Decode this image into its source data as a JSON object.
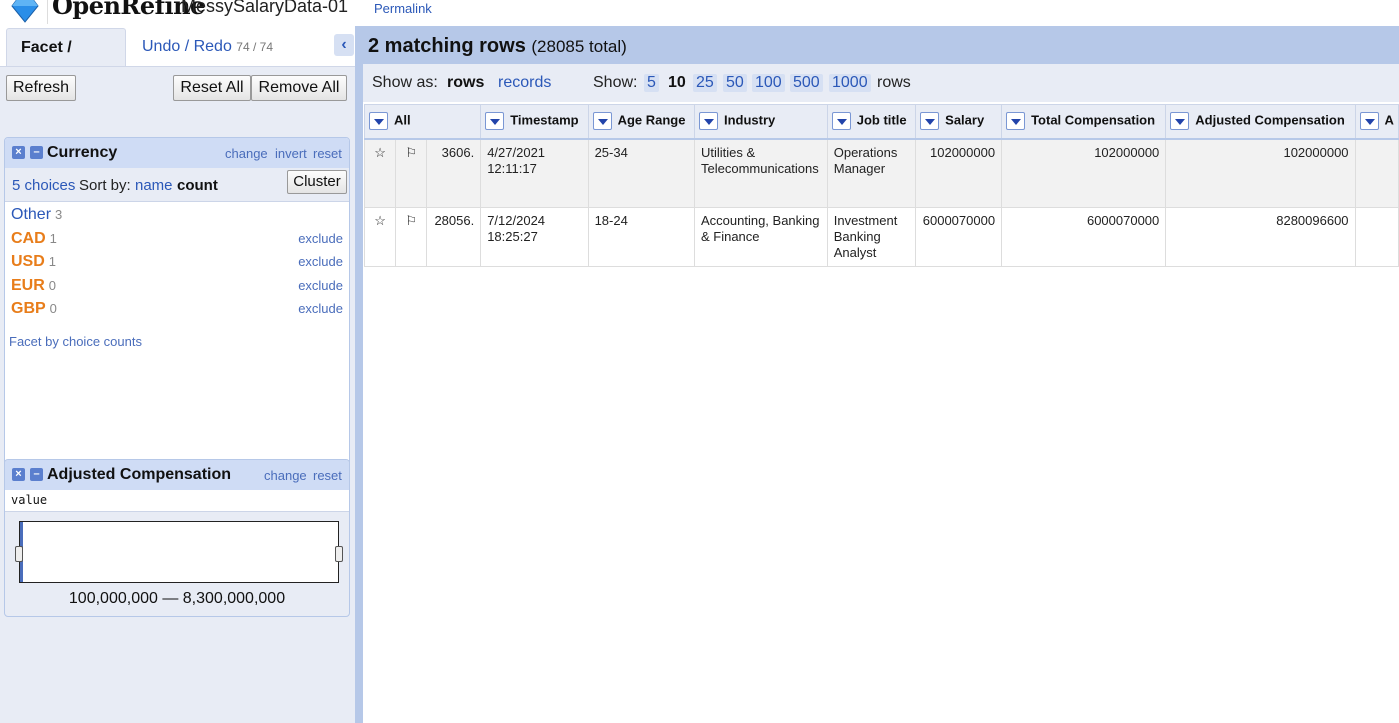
{
  "header": {
    "app_name": "OpenRefine",
    "project_name": "MessySalaryData-01",
    "permalink": "Permalink"
  },
  "left_panel": {
    "tabs": {
      "facet_filter": "Facet / Filter",
      "undo_redo": "Undo / Redo",
      "undo_count": "74 / 74"
    },
    "toolbar": {
      "refresh": "Refresh",
      "reset_all": "Reset All",
      "remove_all": "Remove All"
    },
    "currency_facet": {
      "title": "Currency",
      "actions": {
        "change": "change",
        "invert": "invert",
        "reset": "reset"
      },
      "choices_count": "5 choices",
      "sort_by": "Sort by:",
      "sort_name": "name",
      "sort_count": "count",
      "cluster": "Cluster",
      "choices": [
        {
          "label": "Other",
          "count": "3",
          "exclude": ""
        },
        {
          "label": "CAD",
          "count": "1",
          "exclude": "exclude"
        },
        {
          "label": "USD",
          "count": "1",
          "exclude": "exclude"
        },
        {
          "label": "EUR",
          "count": "0",
          "exclude": "exclude"
        },
        {
          "label": "GBP",
          "count": "0",
          "exclude": "exclude"
        }
      ],
      "facet_by_counts": "Facet by choice counts"
    },
    "adjusted_facet": {
      "title": "Adjusted Compensation",
      "actions": {
        "change": "change",
        "reset": "reset"
      },
      "expression": "value",
      "range": "100,000,000 — 8,300,000,000"
    }
  },
  "right_panel": {
    "summary": {
      "matching": "2 matching rows",
      "total": "(28085 total)"
    },
    "view": {
      "show_as": "Show as:",
      "rows": "rows",
      "records": "records",
      "show": "Show:",
      "page_sizes": [
        "5",
        "10",
        "25",
        "50",
        "100",
        "500",
        "1000"
      ],
      "active_page_size": "10",
      "rows_suffix": "rows"
    },
    "table": {
      "columns": [
        "All",
        "Timestamp",
        "Age Range",
        "Industry",
        "Job title",
        "Salary",
        "Total Compensation",
        "Adjusted Compensation",
        "A"
      ],
      "rows": [
        {
          "index": "3606.",
          "timestamp": "4/27/2021 12:11:17",
          "age_range": "25-34",
          "industry": "Utilities & Telecommunications",
          "job_title": "Operations Manager",
          "salary": "102000000",
          "total_comp": "102000000",
          "adjusted_comp": "102000000"
        },
        {
          "index": "28056.",
          "timestamp": "7/12/2024 18:25:27",
          "age_range": "18-24",
          "industry": "Accounting, Banking & Finance",
          "job_title": "Investment Banking Analyst",
          "salary": "6000070000",
          "total_comp": "6000070000",
          "adjusted_comp": "8280096600"
        }
      ]
    }
  }
}
